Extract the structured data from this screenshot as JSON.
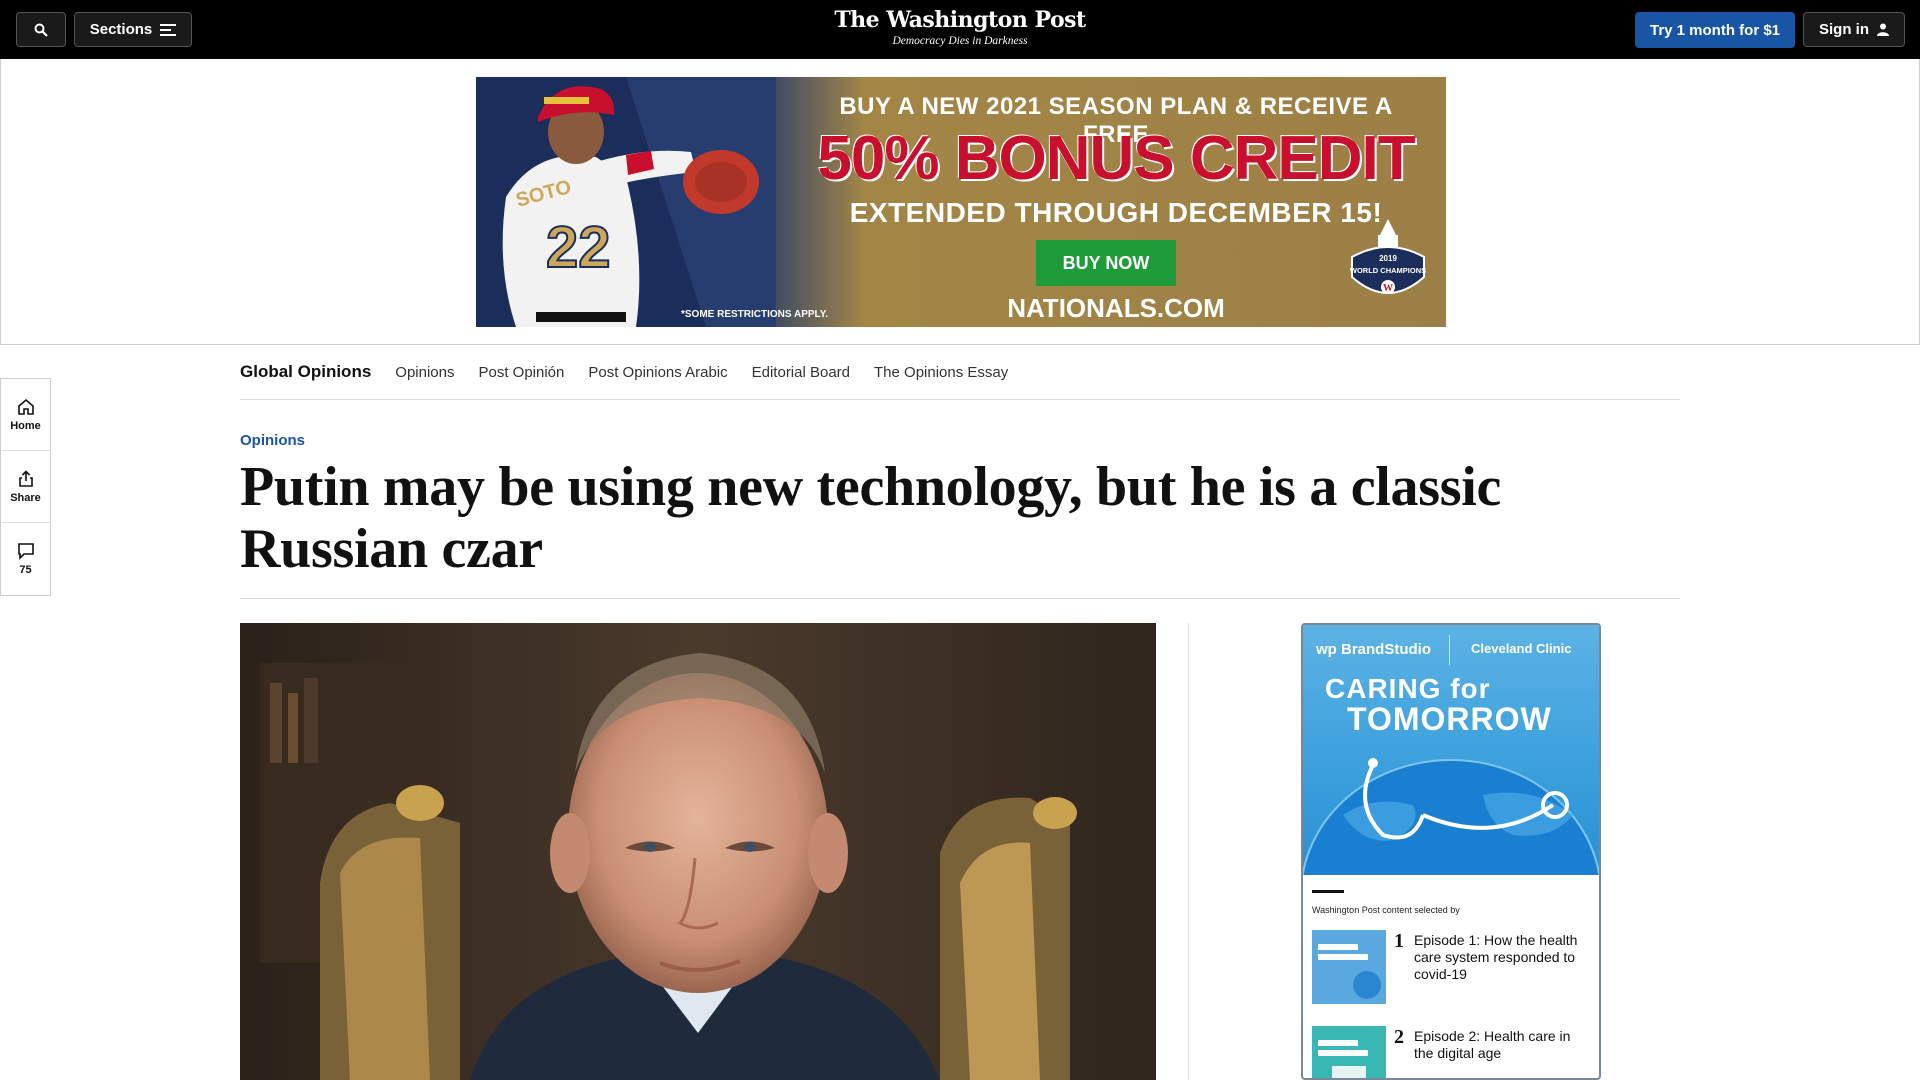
{
  "header": {
    "sections_label": "Sections",
    "logo": "The Washington Post",
    "tagline": "Democracy Dies in Darkness",
    "try_label": "Try 1 month for $1",
    "signin_label": "Sign in"
  },
  "ad": {
    "line1": "BUY A NEW 2021 SEASON PLAN & RECEIVE A FREE",
    "line2": "50% BONUS CREDIT",
    "line3": "EXTENDED THROUGH DECEMBER 15!",
    "cta": "BUY NOW",
    "site": "NATIONALS.COM",
    "fine_print": "*SOME RESTRICTIONS APPLY.",
    "jersey_name": "SOTO",
    "jersey_number": "22",
    "badge_year": "2019",
    "badge_text": "WORLD CHAMPIONS"
  },
  "subnav": {
    "primary": "Global Opinions",
    "links": [
      "Opinions",
      "Post Opinión",
      "Post Opinions Arabic",
      "Editorial Board",
      "The Opinions Essay"
    ]
  },
  "rail": {
    "home": "Home",
    "share": "Share",
    "comments": "75"
  },
  "article": {
    "kicker": "Opinions",
    "headline": "Putin may be using new technology, but he is a classic Russian czar"
  },
  "brand_ad": {
    "logo1": "wp BrandStudio",
    "logo2": "Cleveland Clinic",
    "title1": "CARING for",
    "title2": "TOMORROW",
    "selected_by": "Washington Post content selected by",
    "items": [
      {
        "num": "1",
        "text": "Episode 1: How the health care system responded to covid-19"
      },
      {
        "num": "2",
        "text": "Episode 2: Health care in the digital age"
      }
    ]
  },
  "colors": {
    "topbar": "#000000",
    "accent_blue": "#1955a5",
    "ad_red": "#c8102e",
    "ad_green": "#1f9b3a"
  }
}
